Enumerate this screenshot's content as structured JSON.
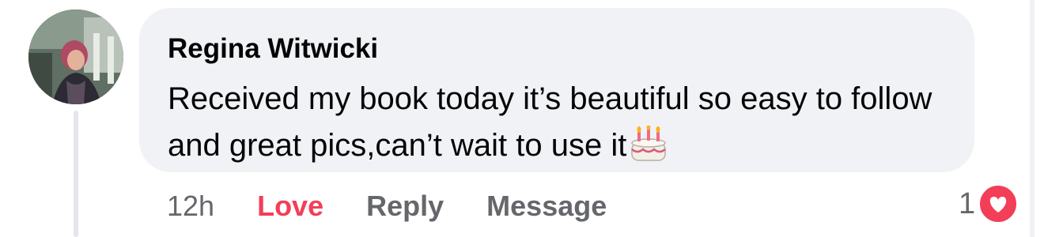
{
  "comment": {
    "author": "Regina Witwicki",
    "text": "Received my book today it’s beautiful so easy to follow and great pics,can’t wait to use it",
    "emoji": "birthday-cake",
    "time": "12h"
  },
  "actions": {
    "love": "Love",
    "reply": "Reply",
    "message": "Message"
  },
  "reactions": {
    "count": "1",
    "type": "love"
  },
  "colors": {
    "bubble": "#f0f2f5",
    "love": "#f33e58",
    "muted": "#65676b",
    "text": "#050505"
  }
}
